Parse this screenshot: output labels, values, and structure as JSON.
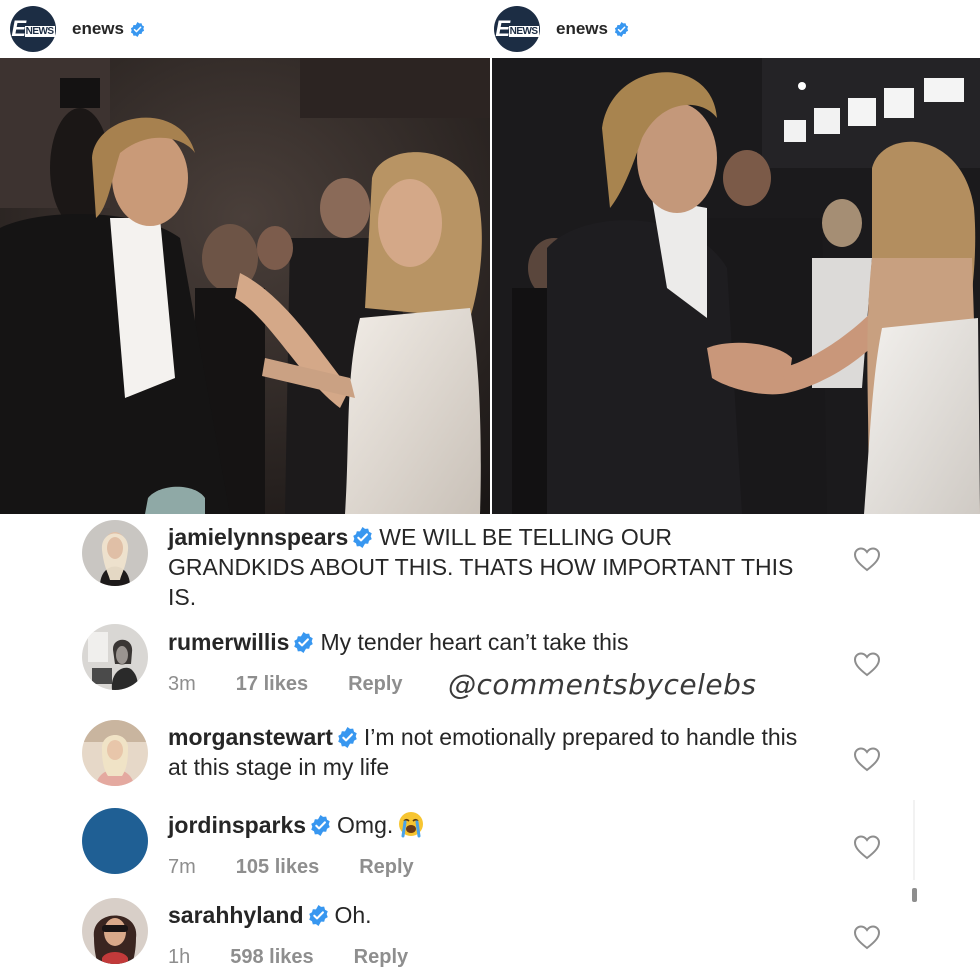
{
  "posts": [
    {
      "account": "enews",
      "verified": true,
      "logo": {
        "letter": "E",
        "word": "NEWS"
      }
    },
    {
      "account": "enews",
      "verified": true,
      "logo": {
        "letter": "E",
        "word": "NEWS"
      }
    }
  ],
  "comments": [
    {
      "username": "jamielynnspears",
      "verified": true,
      "text": "WE WILL BE TELLING OUR GRANDKIDS ABOUT THIS. THATS HOW IMPORTANT THIS IS.",
      "time": "",
      "likes": "",
      "reply": ""
    },
    {
      "username": "rumerwillis",
      "verified": true,
      "text": "My tender heart can’t take this",
      "time": "3m",
      "likes": "17 likes",
      "reply": "Reply"
    },
    {
      "username": "morganstewart",
      "verified": true,
      "text": "I’m not emotionally prepared to handle this at this stage in my life",
      "time": "",
      "likes": "",
      "reply": ""
    },
    {
      "username": "jordinsparks",
      "verified": true,
      "text": "Omg.",
      "emoji": "loudly-crying-face-icon",
      "time": "7m",
      "likes": "105 likes",
      "reply": "Reply"
    },
    {
      "username": "sarahhyland",
      "verified": true,
      "text": "Oh.",
      "time": "1h",
      "likes": "598 likes",
      "reply": "Reply"
    }
  ],
  "watermark": "@commentsbycelebs",
  "colors": {
    "verified_blue": "#3897f0",
    "meta_gray": "#8e8e8e",
    "text": "#262626",
    "logo_navy": "#1c2d44",
    "jordin_avatar": "#1f5f94"
  }
}
